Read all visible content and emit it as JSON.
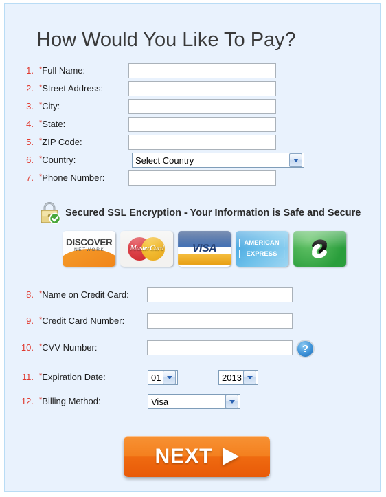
{
  "page": {
    "title": "How Would You Like To Pay?",
    "accent_color": "#ef6a10",
    "panel_color": "#e9f2fd",
    "number_color": "#e03a2f"
  },
  "fields": [
    {
      "num": "1.",
      "label": "Full Name:",
      "required": true,
      "type": "text",
      "value": "",
      "placeholder": ""
    },
    {
      "num": "2.",
      "label": "Street Address:",
      "required": true,
      "type": "text",
      "value": "",
      "placeholder": ""
    },
    {
      "num": "3.",
      "label": "City:",
      "required": true,
      "type": "text",
      "value": "",
      "placeholder": ""
    },
    {
      "num": "4.",
      "label": "State:",
      "required": true,
      "type": "text",
      "value": "",
      "placeholder": ""
    },
    {
      "num": "5.",
      "label": "ZIP Code:",
      "required": true,
      "type": "text",
      "value": "",
      "placeholder": ""
    },
    {
      "num": "6.",
      "label": "Country:",
      "required": true,
      "type": "select",
      "value": "Select Country"
    },
    {
      "num": "7.",
      "label": "Phone Number:",
      "required": true,
      "type": "text",
      "value": "",
      "placeholder": ""
    },
    {
      "num": "8.",
      "label": "Name on Credit Card:",
      "required": true,
      "type": "text",
      "value": "",
      "placeholder": ""
    },
    {
      "num": "9.",
      "label": "Credit Card Number:",
      "required": true,
      "type": "text",
      "value": "",
      "placeholder": ""
    },
    {
      "num": "10.",
      "label": "CVV Number:",
      "required": true,
      "type": "text",
      "value": "",
      "placeholder": ""
    },
    {
      "num": "11.",
      "label": "Expiration Date:",
      "required": true,
      "type": "select-pair",
      "month": "01",
      "year": "2013"
    },
    {
      "num": "12.",
      "label": "Billing Method:",
      "required": true,
      "type": "select",
      "value": "Visa"
    }
  ],
  "security": {
    "icon": "padlock-check-icon",
    "text": "Secured SSL Encryption - Your Information is Safe and Secure"
  },
  "cards": [
    {
      "name": "discover",
      "line1": "DISCOVER",
      "line2": "NETWORK"
    },
    {
      "name": "mastercard",
      "line1": "MasterCard"
    },
    {
      "name": "visa",
      "line1": "VISA"
    },
    {
      "name": "american-express",
      "line1": "AMERICAN",
      "line2": "EXPRESS"
    },
    {
      "name": "green-check-card",
      "line1": ""
    }
  ],
  "help": {
    "symbol": "?"
  },
  "submit": {
    "label": "NEXT"
  }
}
